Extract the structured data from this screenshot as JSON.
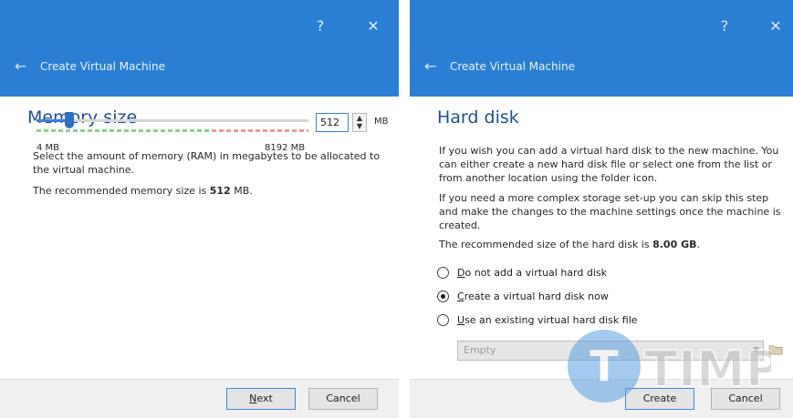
{
  "memory_dialog": {
    "title_bar": {
      "help_icon": "?",
      "close_icon": "✕"
    },
    "back_icon": "←",
    "title": "Create Virtual Machine",
    "page_title": "Memory size",
    "description": "Select the amount of memory (RAM) in megabytes to be allocated to the virtual machine.",
    "recommended_prefix": "The recommended memory size is ",
    "recommended_value": "512",
    "recommended_suffix": " MB.",
    "slider": {
      "value_mb": 512,
      "min_mb": 4,
      "max_mb": 8192,
      "min_label": "4 MB",
      "max_label": "8192 MB"
    },
    "memory_input_value": "512",
    "unit_label": "MB",
    "next_mnemonic": "N",
    "next_rest": "ext",
    "cancel_label": "Cancel"
  },
  "disk_dialog": {
    "title_bar": {
      "help_icon": "?",
      "close_icon": "✕"
    },
    "back_icon": "←",
    "title": "Create Virtual Machine",
    "page_title": "Hard disk",
    "para1": "If you wish you can add a virtual hard disk to the new machine. You can either create a new hard disk file or select one from the list or from another location using the folder icon.",
    "para2": "If you need a more complex storage set-up you can skip this step and make the changes to the machine settings once the machine is created.",
    "recommended_prefix": "The recommended size of the hard disk is ",
    "recommended_value": "8.00 GB",
    "recommended_suffix": ".",
    "options": [
      {
        "mnemonic": "D",
        "rest": "o not add a virtual hard disk",
        "selected": false
      },
      {
        "mnemonic": "C",
        "rest": "reate a virtual hard disk now",
        "selected": true
      },
      {
        "mnemonic": "U",
        "rest": "se an existing virtual hard disk file",
        "selected": false
      }
    ],
    "existing_file_combo": "Empty",
    "create_label": "Create",
    "cancel_label": "Cancel"
  },
  "watermark": {
    "text": "TIMP"
  },
  "colors": {
    "title_bar": "#2a7fd4",
    "heading": "#1f4e99",
    "accent": "#3b7fd4"
  }
}
